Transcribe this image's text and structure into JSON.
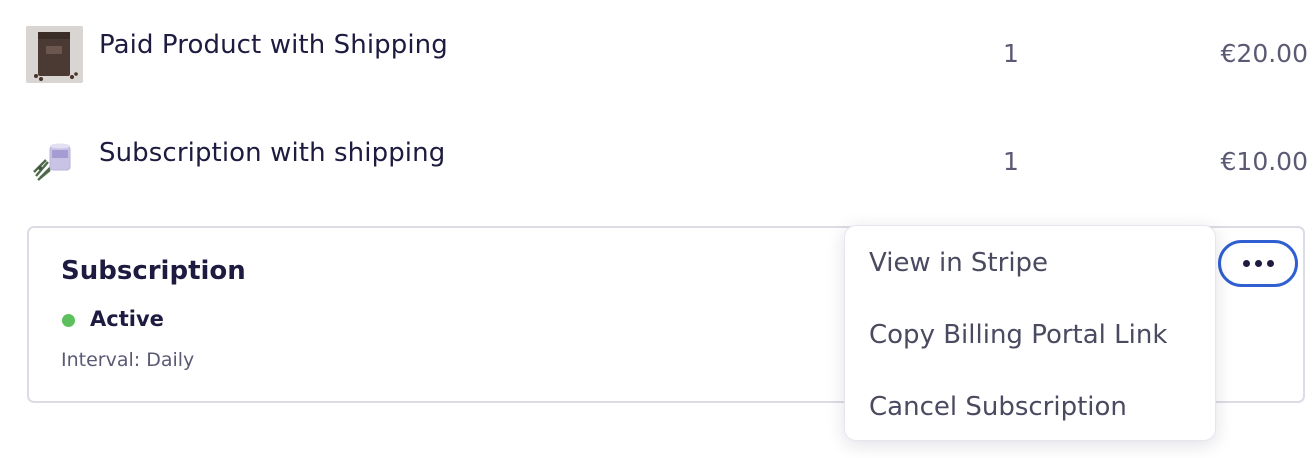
{
  "line_items": [
    {
      "name": "Paid Product with Shipping",
      "quantity": "1",
      "price": "€20.00",
      "thumbnail": "coffee-bag-image"
    },
    {
      "name": "Subscription with shipping",
      "quantity": "1",
      "price": "€10.00",
      "thumbnail": "lavender-candle-image"
    }
  ],
  "subscription": {
    "title": "Subscription",
    "status": "Active",
    "status_color": "#5cc15c",
    "interval": "Interval: Daily",
    "more_icon": "more-horizontal-icon"
  },
  "menu": {
    "items": [
      "View in Stripe",
      "Copy Billing Portal Link",
      "Cancel Subscription"
    ]
  },
  "colors": {
    "text_primary": "#1d1b3f",
    "text_secondary": "#5b5a75",
    "accent": "#2f5fd0",
    "border": "#dcdce4"
  }
}
